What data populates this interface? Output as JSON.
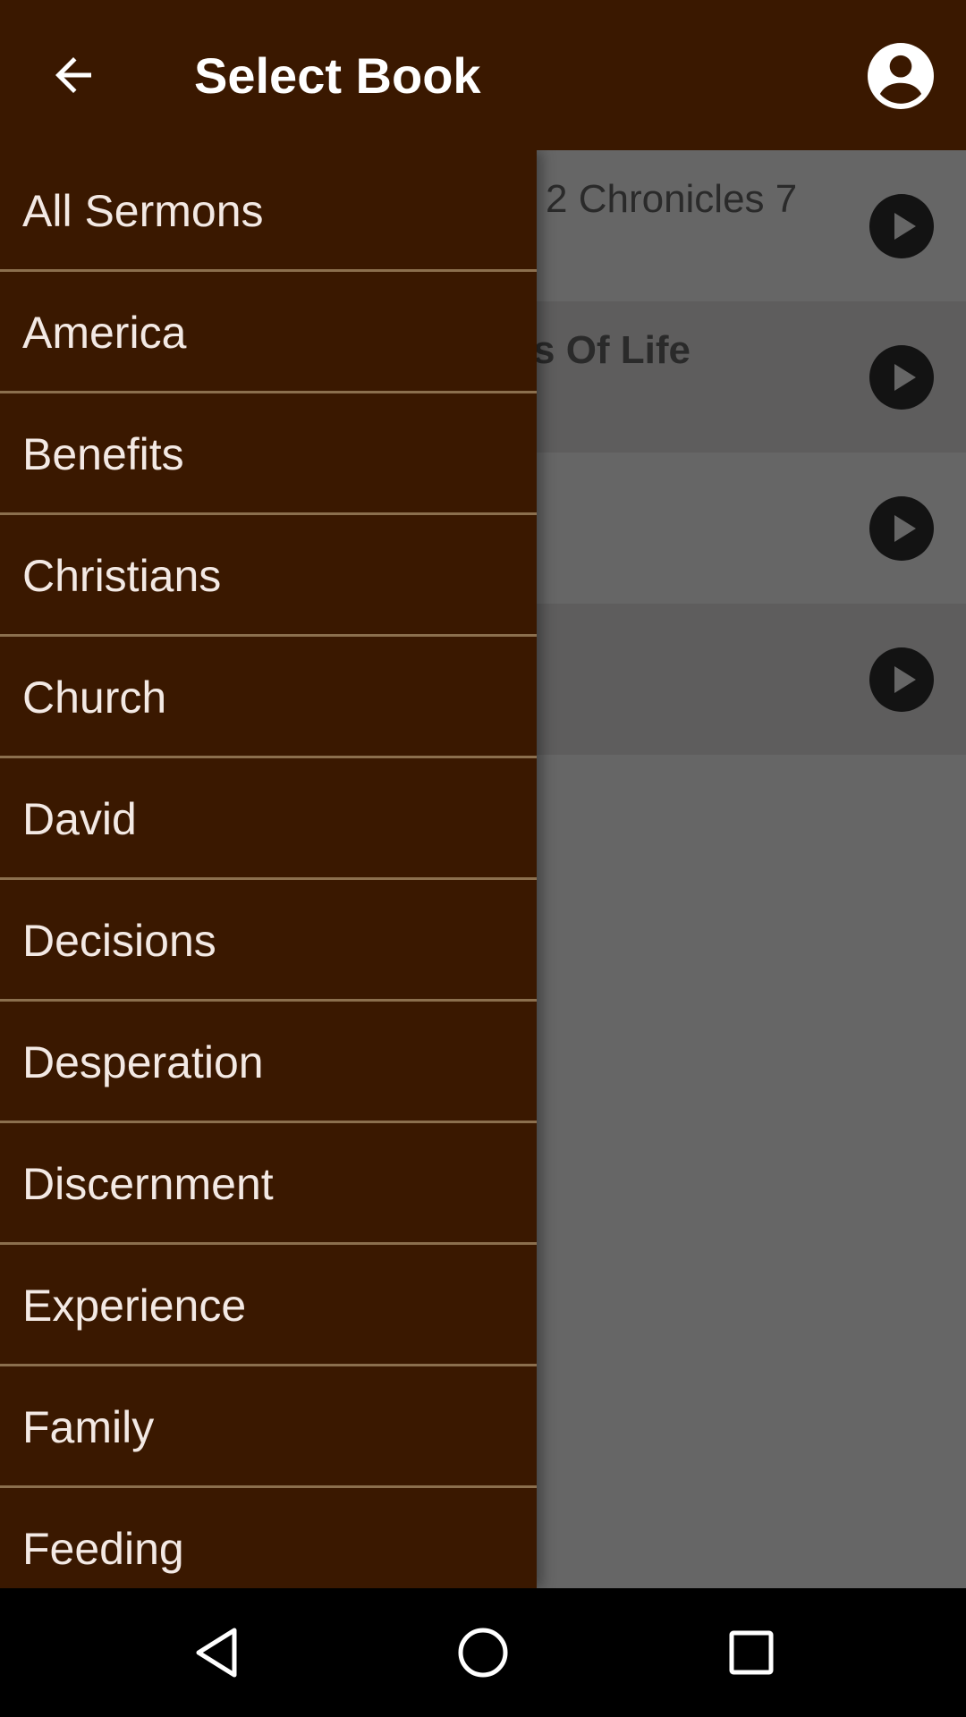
{
  "appbar": {
    "title": "Select Book",
    "back_icon": "arrow-left-icon",
    "profile_icon": "account-circle-icon",
    "background": "#3a1800"
  },
  "drawer": {
    "items": [
      {
        "label": "All Sermons"
      },
      {
        "label": "America"
      },
      {
        "label": "Benefits"
      },
      {
        "label": "Christians"
      },
      {
        "label": "Church"
      },
      {
        "label": "David"
      },
      {
        "label": "Decisions"
      },
      {
        "label": "Desperation"
      },
      {
        "label": "Discernment"
      },
      {
        "label": "Experience"
      },
      {
        "label": "Family"
      },
      {
        "label": "Feeding"
      }
    ],
    "divider_color": "#8b6f4e"
  },
  "background_list": {
    "rows": [
      {
        "title": "2 Chronicles 7"
      },
      {
        "title": "s Of Life"
      },
      {
        "title": ""
      },
      {
        "title": ""
      }
    ]
  },
  "navbar": {
    "back": "nav-back-icon",
    "home": "nav-home-icon",
    "recents": "nav-recents-icon"
  }
}
